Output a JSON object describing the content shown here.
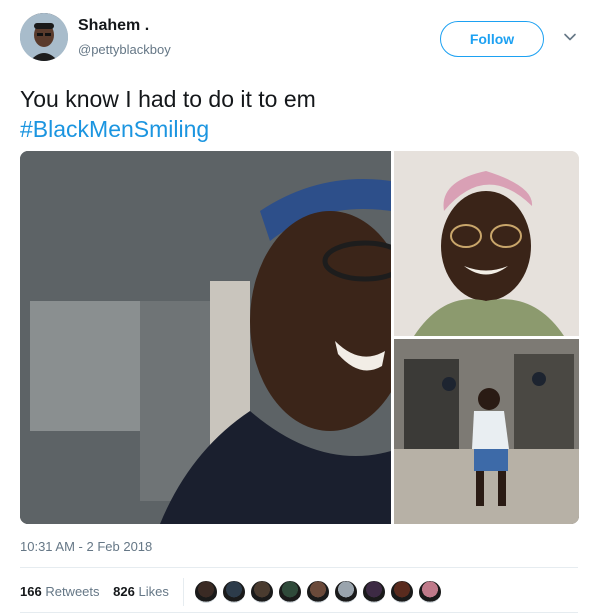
{
  "tweet": {
    "display_name": "Shahem .",
    "handle": "@pettyblackboy",
    "follow_label": "Follow",
    "text": "You know I had to do it to em",
    "hashtag": "#BlackMenSmiling",
    "timestamp": "10:31 AM - 2 Feb 2018"
  },
  "stats": {
    "retweets_count": "166",
    "retweets_label": "Retweets",
    "likes_count": "826",
    "likes_label": "Likes"
  },
  "likers": [
    {
      "name": "liker-avatar",
      "color": "#3a2a24"
    },
    {
      "name": "liker-avatar",
      "color": "#2c3b4a"
    },
    {
      "name": "liker-avatar",
      "color": "#4a3b2f"
    },
    {
      "name": "liker-avatar",
      "color": "#2f4a3a"
    },
    {
      "name": "liker-avatar",
      "color": "#6b4a3a"
    },
    {
      "name": "liker-avatar",
      "color": "#9aa4ad"
    },
    {
      "name": "liker-avatar",
      "color": "#3d2a44"
    },
    {
      "name": "liker-avatar",
      "color": "#5a2b1e"
    },
    {
      "name": "liker-avatar",
      "color": "#c07a8a"
    }
  ],
  "colors": {
    "accent": "#1da1f2",
    "hashtag": "#1b95e0",
    "muted": "#657786"
  },
  "icons": {
    "caret": "chevron-down-icon"
  }
}
